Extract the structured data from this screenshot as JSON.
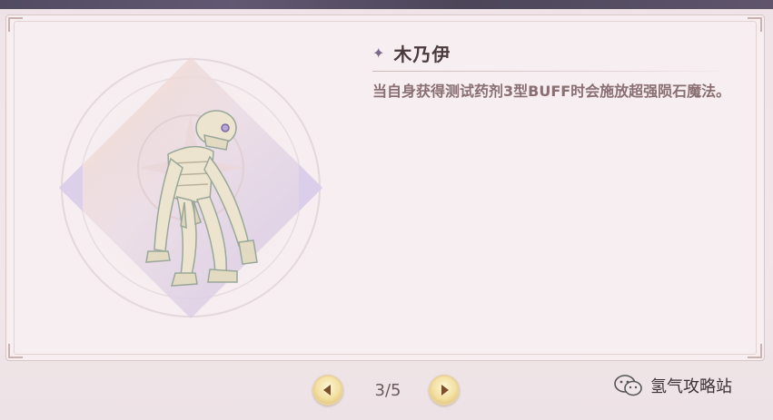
{
  "monster_card": {
    "name": "木乃伊",
    "description": "当自身获得测试药剂3型BUFF时会施放超强陨石魔法。",
    "portrait_icon": "mummy-portrait"
  },
  "pager": {
    "indicator": "3/5",
    "prev_icon": "arrow-left-icon",
    "next_icon": "arrow-right-icon"
  },
  "watermark": {
    "text": "氢气攻略站",
    "icon": "wechat-icon"
  },
  "colors": {
    "title": "#4b3a3d",
    "description": "#8a6f72",
    "accent_star": "#7c6a8a",
    "button_gold": "#f3dfa0"
  }
}
